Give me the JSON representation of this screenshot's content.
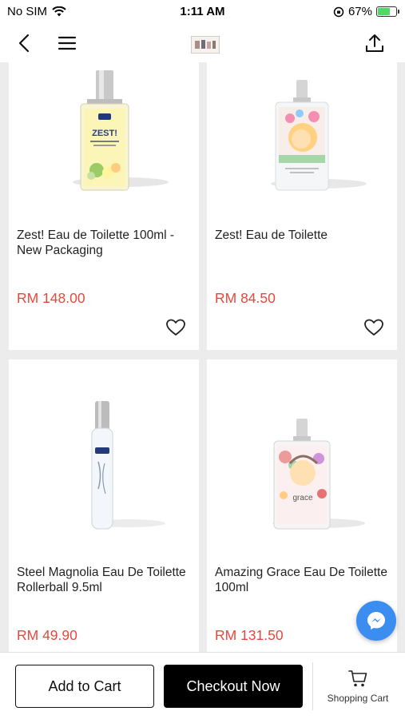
{
  "status_bar": {
    "carrier": "No SIM",
    "time": "1:11 AM",
    "battery": "67%"
  },
  "nav": {
    "back_icon": "chevron-left-icon",
    "menu_icon": "hamburger-icon",
    "share_icon": "share-icon"
  },
  "products": [
    {
      "name": "Zest! Eau de Toilette 100ml - New Packaging",
      "price": "RM 148.00"
    },
    {
      "name": "Zest! Eau de Toilette",
      "price": "RM 84.50"
    },
    {
      "name": "Steel Magnolia Eau De Toilette Rollerball 9.5ml",
      "price": "RM 49.90"
    },
    {
      "name": "Amazing Grace Eau De Toilette 100ml",
      "price": "RM 131.50"
    }
  ],
  "bottom_bar": {
    "add_to_cart": "Add to Cart",
    "checkout": "Checkout Now",
    "cart_label": "Shopping Cart"
  },
  "colors": {
    "price": "#e8463b",
    "messenger": "#3b8df0"
  }
}
